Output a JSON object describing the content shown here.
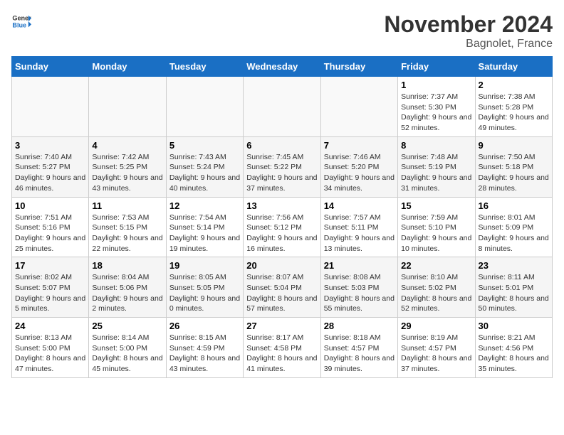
{
  "header": {
    "logo_general": "General",
    "logo_blue": "Blue",
    "month": "November 2024",
    "location": "Bagnolet, France"
  },
  "days_of_week": [
    "Sunday",
    "Monday",
    "Tuesday",
    "Wednesday",
    "Thursday",
    "Friday",
    "Saturday"
  ],
  "weeks": [
    [
      {
        "day": "",
        "info": ""
      },
      {
        "day": "",
        "info": ""
      },
      {
        "day": "",
        "info": ""
      },
      {
        "day": "",
        "info": ""
      },
      {
        "day": "",
        "info": ""
      },
      {
        "day": "1",
        "info": "Sunrise: 7:37 AM\nSunset: 5:30 PM\nDaylight: 9 hours and 52 minutes."
      },
      {
        "day": "2",
        "info": "Sunrise: 7:38 AM\nSunset: 5:28 PM\nDaylight: 9 hours and 49 minutes."
      }
    ],
    [
      {
        "day": "3",
        "info": "Sunrise: 7:40 AM\nSunset: 5:27 PM\nDaylight: 9 hours and 46 minutes."
      },
      {
        "day": "4",
        "info": "Sunrise: 7:42 AM\nSunset: 5:25 PM\nDaylight: 9 hours and 43 minutes."
      },
      {
        "day": "5",
        "info": "Sunrise: 7:43 AM\nSunset: 5:24 PM\nDaylight: 9 hours and 40 minutes."
      },
      {
        "day": "6",
        "info": "Sunrise: 7:45 AM\nSunset: 5:22 PM\nDaylight: 9 hours and 37 minutes."
      },
      {
        "day": "7",
        "info": "Sunrise: 7:46 AM\nSunset: 5:20 PM\nDaylight: 9 hours and 34 minutes."
      },
      {
        "day": "8",
        "info": "Sunrise: 7:48 AM\nSunset: 5:19 PM\nDaylight: 9 hours and 31 minutes."
      },
      {
        "day": "9",
        "info": "Sunrise: 7:50 AM\nSunset: 5:18 PM\nDaylight: 9 hours and 28 minutes."
      }
    ],
    [
      {
        "day": "10",
        "info": "Sunrise: 7:51 AM\nSunset: 5:16 PM\nDaylight: 9 hours and 25 minutes."
      },
      {
        "day": "11",
        "info": "Sunrise: 7:53 AM\nSunset: 5:15 PM\nDaylight: 9 hours and 22 minutes."
      },
      {
        "day": "12",
        "info": "Sunrise: 7:54 AM\nSunset: 5:14 PM\nDaylight: 9 hours and 19 minutes."
      },
      {
        "day": "13",
        "info": "Sunrise: 7:56 AM\nSunset: 5:12 PM\nDaylight: 9 hours and 16 minutes."
      },
      {
        "day": "14",
        "info": "Sunrise: 7:57 AM\nSunset: 5:11 PM\nDaylight: 9 hours and 13 minutes."
      },
      {
        "day": "15",
        "info": "Sunrise: 7:59 AM\nSunset: 5:10 PM\nDaylight: 9 hours and 10 minutes."
      },
      {
        "day": "16",
        "info": "Sunrise: 8:01 AM\nSunset: 5:09 PM\nDaylight: 9 hours and 8 minutes."
      }
    ],
    [
      {
        "day": "17",
        "info": "Sunrise: 8:02 AM\nSunset: 5:07 PM\nDaylight: 9 hours and 5 minutes."
      },
      {
        "day": "18",
        "info": "Sunrise: 8:04 AM\nSunset: 5:06 PM\nDaylight: 9 hours and 2 minutes."
      },
      {
        "day": "19",
        "info": "Sunrise: 8:05 AM\nSunset: 5:05 PM\nDaylight: 9 hours and 0 minutes."
      },
      {
        "day": "20",
        "info": "Sunrise: 8:07 AM\nSunset: 5:04 PM\nDaylight: 8 hours and 57 minutes."
      },
      {
        "day": "21",
        "info": "Sunrise: 8:08 AM\nSunset: 5:03 PM\nDaylight: 8 hours and 55 minutes."
      },
      {
        "day": "22",
        "info": "Sunrise: 8:10 AM\nSunset: 5:02 PM\nDaylight: 8 hours and 52 minutes."
      },
      {
        "day": "23",
        "info": "Sunrise: 8:11 AM\nSunset: 5:01 PM\nDaylight: 8 hours and 50 minutes."
      }
    ],
    [
      {
        "day": "24",
        "info": "Sunrise: 8:13 AM\nSunset: 5:00 PM\nDaylight: 8 hours and 47 minutes."
      },
      {
        "day": "25",
        "info": "Sunrise: 8:14 AM\nSunset: 5:00 PM\nDaylight: 8 hours and 45 minutes."
      },
      {
        "day": "26",
        "info": "Sunrise: 8:15 AM\nSunset: 4:59 PM\nDaylight: 8 hours and 43 minutes."
      },
      {
        "day": "27",
        "info": "Sunrise: 8:17 AM\nSunset: 4:58 PM\nDaylight: 8 hours and 41 minutes."
      },
      {
        "day": "28",
        "info": "Sunrise: 8:18 AM\nSunset: 4:57 PM\nDaylight: 8 hours and 39 minutes."
      },
      {
        "day": "29",
        "info": "Sunrise: 8:19 AM\nSunset: 4:57 PM\nDaylight: 8 hours and 37 minutes."
      },
      {
        "day": "30",
        "info": "Sunrise: 8:21 AM\nSunset: 4:56 PM\nDaylight: 8 hours and 35 minutes."
      }
    ]
  ]
}
